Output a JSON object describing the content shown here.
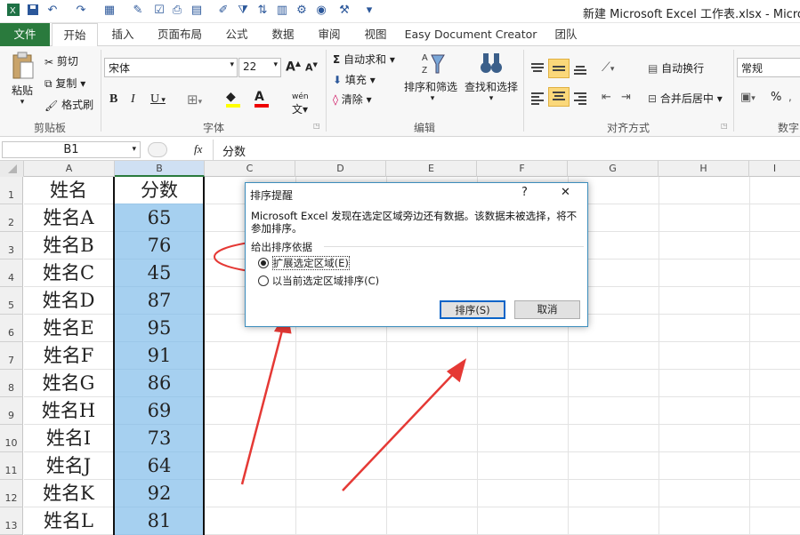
{
  "title_bar": {
    "text": "新建 Microsoft Excel 工作表.xlsx - Microsoft"
  },
  "tabs": [
    "文件",
    "开始",
    "插入",
    "页面布局",
    "公式",
    "数据",
    "审阅",
    "视图",
    "Easy Document Creator",
    "团队"
  ],
  "clipboard": {
    "paste": "粘贴",
    "cut": "剪切",
    "copy": "复制",
    "format_painter": "格式刷",
    "group": "剪贴板"
  },
  "font": {
    "name": "宋体",
    "size": "22",
    "bold": "B",
    "italic": "I",
    "underline": "U",
    "group": "字体",
    "grow": "A",
    "shrink": "A",
    "phonetic": "wén"
  },
  "editing": {
    "autosum": "自动求和",
    "fill": "填充",
    "clear": "清除",
    "sort_filter": "排序和筛选",
    "find_select": "查找和选择",
    "group": "编辑"
  },
  "alignment": {
    "wrap": "自动换行",
    "merge": "合并后居中",
    "group": "对齐方式"
  },
  "number": {
    "format": "常规",
    "percent": "%",
    "group": "数字"
  },
  "formula_bar": {
    "name_box": "B1",
    "fx": "fx",
    "value": "分数"
  },
  "columns": [
    "A",
    "B",
    "C",
    "D",
    "E",
    "F",
    "G",
    "H",
    "I"
  ],
  "rows": [
    {
      "n": "1",
      "a": "姓名",
      "b": "分数"
    },
    {
      "n": "2",
      "a": "姓名A",
      "b": "65"
    },
    {
      "n": "3",
      "a": "姓名B",
      "b": "76"
    },
    {
      "n": "4",
      "a": "姓名C",
      "b": "45"
    },
    {
      "n": "5",
      "a": "姓名D",
      "b": "87"
    },
    {
      "n": "6",
      "a": "姓名E",
      "b": "95"
    },
    {
      "n": "7",
      "a": "姓名F",
      "b": "91"
    },
    {
      "n": "8",
      "a": "姓名G",
      "b": "86"
    },
    {
      "n": "9",
      "a": "姓名H",
      "b": "69"
    },
    {
      "n": "10",
      "a": "姓名I",
      "b": "73"
    },
    {
      "n": "11",
      "a": "姓名J",
      "b": "64"
    },
    {
      "n": "12",
      "a": "姓名K",
      "b": "92"
    },
    {
      "n": "13",
      "a": "姓名L",
      "b": "81"
    }
  ],
  "dialog": {
    "title": "排序提醒",
    "help": "?",
    "close": "✕",
    "message": "Microsoft Excel 发现在选定区域旁边还有数据。该数据未被选择，将不参加排序。",
    "group_label": "给出排序依据",
    "option_expand": "扩展选定区域(E)",
    "option_current": "以当前选定区域排序(C)",
    "sort_button": "排序(S)",
    "cancel_button": "取消"
  },
  "colors": {
    "selection": "#a6d0f0",
    "file_tab": "#2a7a3d",
    "annotation": "#e53935"
  }
}
